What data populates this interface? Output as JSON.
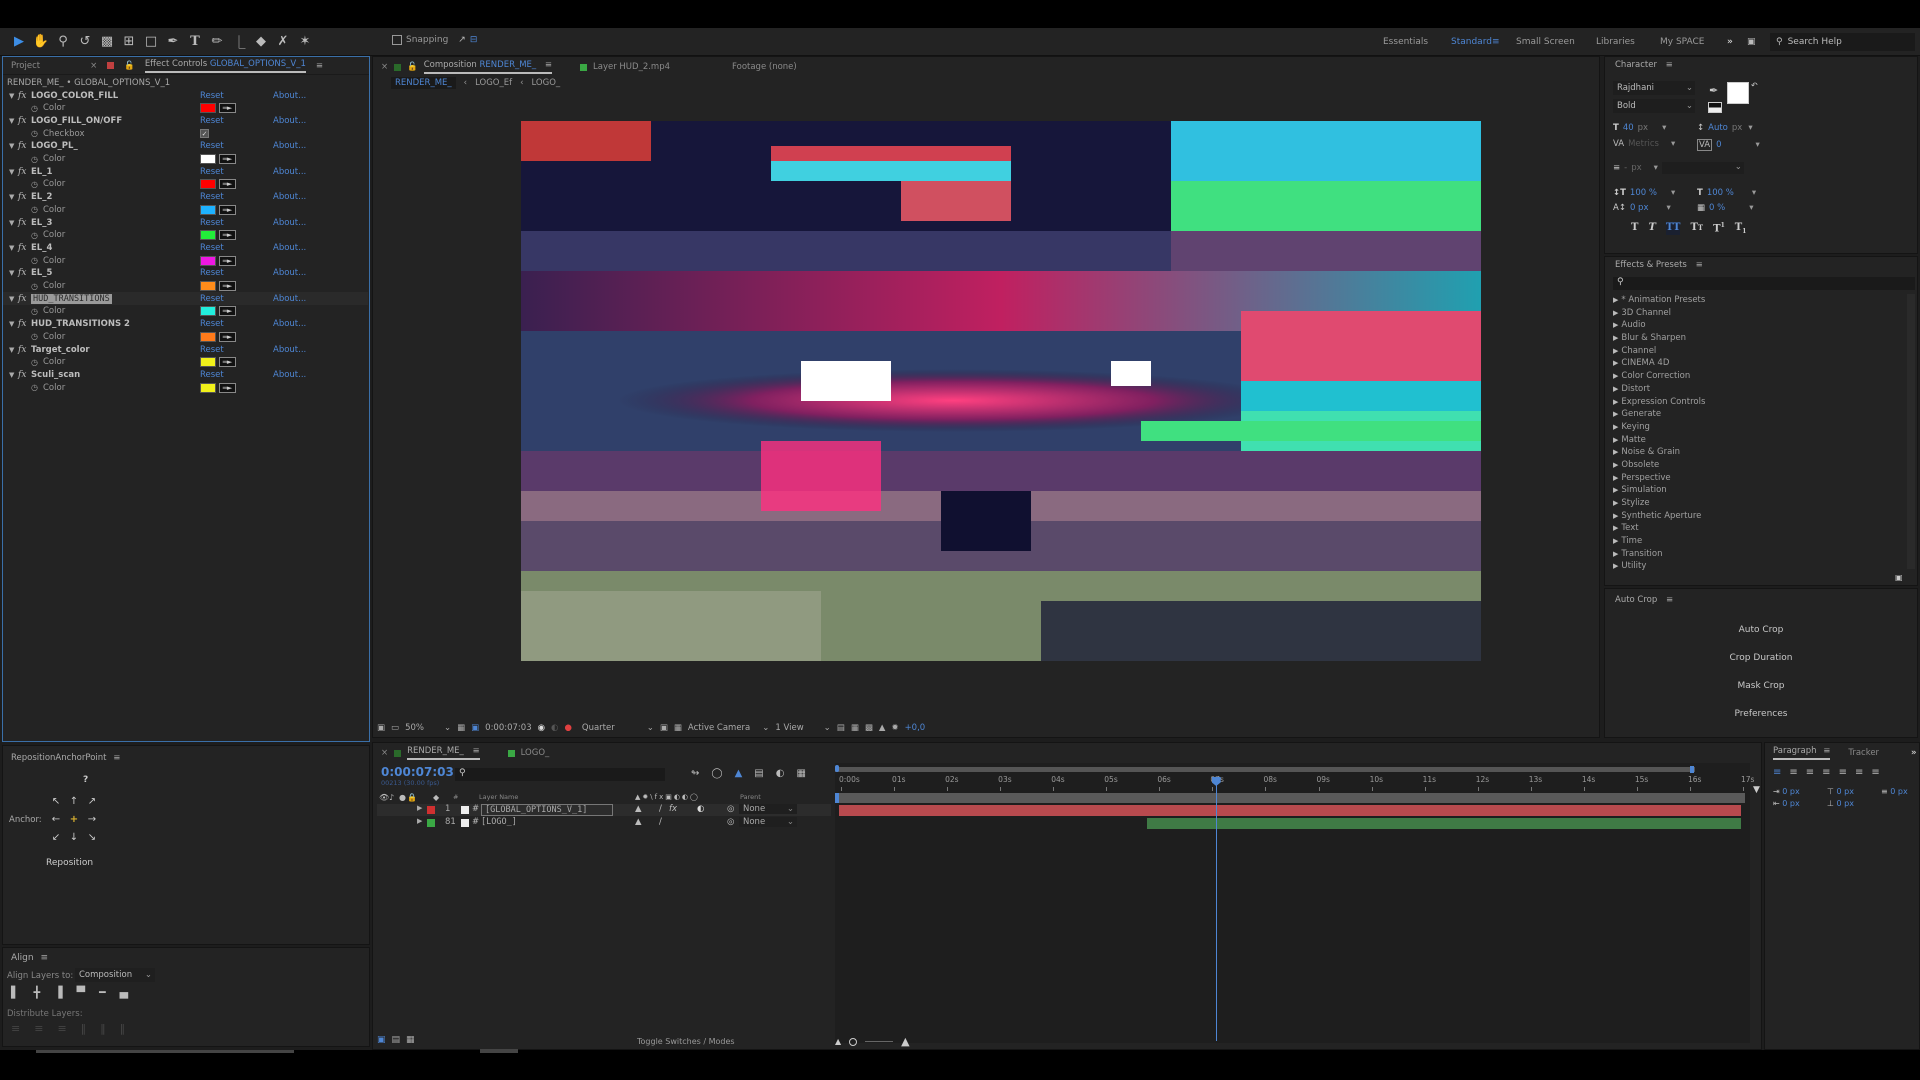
{
  "toolbar": {
    "tools": [
      "selection-tool",
      "hand-tool",
      "zoom-tool",
      "rotate-tool",
      "camera-tool",
      "pan-behind-tool",
      "rectangle-tool",
      "pen-tool",
      "type-tool",
      "brush-tool",
      "clone-stamp-tool",
      "eraser-tool",
      "roto-brush-tool",
      "puppet-pin-tool"
    ],
    "snapping_label": "Snapping",
    "workspaces": [
      "Essentials",
      "Standard",
      "Small Screen",
      "Libraries",
      "My SPACE"
    ],
    "active_workspace": "Standard",
    "search_help": "Search Help"
  },
  "left_panel": {
    "tab_project": "Project",
    "tab_effect_controls_prefix": "Effect Controls",
    "tab_effect_controls_layer": "GLOBAL_OPTIONS_V_1",
    "breadcrumb": "RENDER_ME_ • GLOBAL_OPTIONS_V_1",
    "reset_label": "Reset",
    "about_label": "About...",
    "effects": [
      {
        "name": "LOGO_COLOR_FILL",
        "prop": "Color",
        "type": "color",
        "color": "#ff0000"
      },
      {
        "name": "LOGO_FILL_ON/OFF",
        "prop": "Checkbox",
        "type": "checkbox",
        "checked": true
      },
      {
        "name": "LOGO_PL_",
        "prop": "Color",
        "type": "color",
        "color": "#ffffff"
      },
      {
        "name": "EL_1",
        "prop": "Color",
        "type": "color",
        "color": "#ff0000"
      },
      {
        "name": "EL_2",
        "prop": "Color",
        "type": "color",
        "color": "#1eb2ff"
      },
      {
        "name": "EL_3",
        "prop": "Color",
        "type": "color",
        "color": "#22ee3a"
      },
      {
        "name": "EL_4",
        "prop": "Color",
        "type": "color",
        "color": "#ee18e2"
      },
      {
        "name": "EL_5",
        "prop": "Color",
        "type": "color",
        "color": "#ff8c1a"
      },
      {
        "name": "HUD_TRANSITIONS",
        "prop": "Color",
        "type": "color",
        "color": "#22eedd",
        "selected": true
      },
      {
        "name": "HUD_TRANSITIONS 2",
        "prop": "Color",
        "type": "color",
        "color": "#ff7a1a"
      },
      {
        "name": "Target_color",
        "prop": "Color",
        "type": "color",
        "color": "#f0f01a"
      },
      {
        "name": "Sculi_scan",
        "prop": "Color",
        "type": "color",
        "color": "#f0f01a"
      }
    ]
  },
  "comp_panel": {
    "tab_comp_prefix": "Composition",
    "tab_comp_name": "RENDER_ME_",
    "tab_layer": "Layer HUD_2.mp4",
    "tab_footage": "Footage (none)",
    "breadcrumbs": [
      "RENDER_ME_",
      "LOGO_Ef",
      "LOGO_"
    ],
    "viewer_bar": {
      "zoom": "50%",
      "timecode": "0:00:07:03",
      "resolution": "Quarter",
      "camera": "Active Camera",
      "views": "1 View",
      "exposure": "+0,0"
    }
  },
  "character": {
    "title": "Character",
    "font": "Rajdhani",
    "style": "Bold",
    "font_size": "40",
    "font_size_unit": "px",
    "leading": "Auto",
    "leading_unit": "px",
    "kerning": "Metrics",
    "tracking": "0",
    "stroke_width": "-",
    "stroke_unit": "px",
    "vscale": "100 %",
    "hscale": "100 %",
    "baseline": "0 px",
    "tsume": "0 %",
    "fill_color": "#ffffff"
  },
  "effects_presets": {
    "title": "Effects & Presets",
    "categories": [
      "* Animation Presets",
      "3D Channel",
      "Audio",
      "Blur & Sharpen",
      "Channel",
      "CINEMA 4D",
      "Color Correction",
      "Distort",
      "Expression Controls",
      "Generate",
      "Keying",
      "Matte",
      "Noise & Grain",
      "Obsolete",
      "Perspective",
      "Simulation",
      "Stylize",
      "Synthetic Aperture",
      "Text",
      "Time",
      "Transition",
      "Utility"
    ]
  },
  "auto_crop": {
    "title": "Auto Crop",
    "buttons": [
      "Auto Crop",
      "Crop Duration",
      "Mask Crop",
      "Preferences"
    ]
  },
  "reposition": {
    "title": "RepositionAnchorPoint",
    "help": "?",
    "anchor_label": "Anchor:",
    "button": "Reposition"
  },
  "align": {
    "title": "Align",
    "align_to_label": "Align Layers to:",
    "align_to_value": "Composition",
    "distribute_label": "Distribute Layers:"
  },
  "timeline": {
    "tab_active": "RENDER_ME_",
    "tab_other": "LOGO_",
    "timecode": "0:00:07:03",
    "frame_info": "00213 (30.00 fps)",
    "col_layer_name": "Layer Name",
    "col_parent": "Parent",
    "col_num": "#",
    "ruler": [
      "0:00s",
      "01s",
      "02s",
      "03s",
      "04s",
      "05s",
      "06s",
      "07s",
      "08s",
      "09s",
      "10s",
      "11s",
      "12s",
      "13s",
      "14s",
      "15s",
      "16s",
      "17s"
    ],
    "playhead_seconds": 7.1,
    "duration_seconds": 17,
    "layers": [
      {
        "num": "1",
        "name": "[GLOBAL_OPTIONS_V_1]",
        "label_color": "#d03030",
        "parent": "None",
        "bar_color": "#b84a4e",
        "start": 0,
        "end": 17,
        "selected": true
      },
      {
        "num": "81",
        "name": "[LOGO_]",
        "label_color": "#3aa844",
        "parent": "None",
        "bar_color": "#3f7a45",
        "start": 5.8,
        "end": 17
      }
    ],
    "toggle_label": "Toggle Switches / Modes"
  },
  "paragraph": {
    "tab_paragraph": "Paragraph",
    "tab_tracker": "Tracker",
    "indent_values": [
      "0 px",
      "0 px",
      "0 px",
      "0 px",
      "0 px"
    ]
  }
}
